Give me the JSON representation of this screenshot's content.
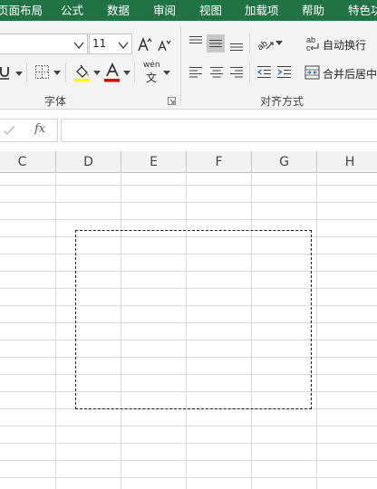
{
  "menubar": {
    "tabs": [
      "页面布局",
      "公式",
      "数据",
      "审阅",
      "视图",
      "加载项",
      "帮助",
      "特色功"
    ]
  },
  "ribbon": {
    "font_size": "11",
    "font_group_label": "字体",
    "align_group_label": "对齐方式",
    "wrap_text_label": "自动换行",
    "merge_center_label": "合并后居中",
    "phonetic_glyph": "wén",
    "phonetic_sub": "文",
    "colors": {
      "highlight": "#ffff00",
      "font_color": "#e00000",
      "selected": "#c8c8c8"
    }
  },
  "formula_bar": {
    "fx_label": "fx",
    "value": ""
  },
  "sheet": {
    "columns": [
      "C",
      "D",
      "E",
      "F",
      "G",
      "H"
    ]
  }
}
